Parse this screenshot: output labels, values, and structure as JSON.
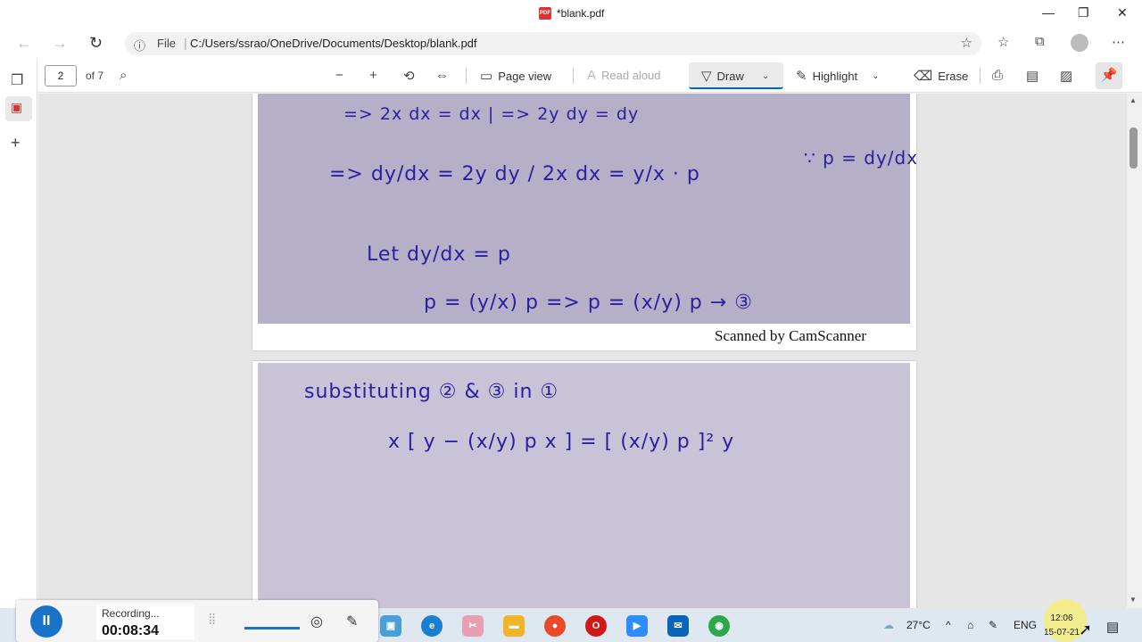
{
  "window": {
    "title": "*blank.pdf",
    "pdf_badge": "PDF",
    "minimize": "—",
    "restore": "❐",
    "close": "✕"
  },
  "address": {
    "info_icon": "ⓘ",
    "file_label": "File",
    "separator": "|",
    "url": "C:/Users/ssrao/OneDrive/Documents/Desktop/blank.pdf"
  },
  "toolbar": {
    "page_number": "2",
    "of_pages": "of 7",
    "page_view": "Page view",
    "read_aloud": "Read aloud",
    "draw": "Draw",
    "highlight": "Highlight",
    "erase": "Erase"
  },
  "document": {
    "page1_lines": [
      "=> 2x dx = dx  | => 2y dy = dy",
      "=> dy/dx = 2y dy / 2x dx = y/x · p",
      "∵ p = dy/dx",
      "Let  dy/dx = p",
      "p = (y/x) p   => p = (x/y) p  → ③"
    ],
    "footer": "Scanned by CamScanner",
    "page2_lines": [
      "substituting ② & ③ in ①",
      "x [ y − (x/y) p x ] = [ (x/y) p ]² y"
    ]
  },
  "recorder": {
    "status": "Recording...",
    "time": "00:08:34"
  },
  "tray": {
    "temperature": "27°C",
    "language": "ENG",
    "time": "12:06",
    "date": "15-07-21"
  },
  "colors": {
    "ink": "#2a1fa0",
    "scan_background": "#b5afc7",
    "accent": "#0067c0"
  }
}
